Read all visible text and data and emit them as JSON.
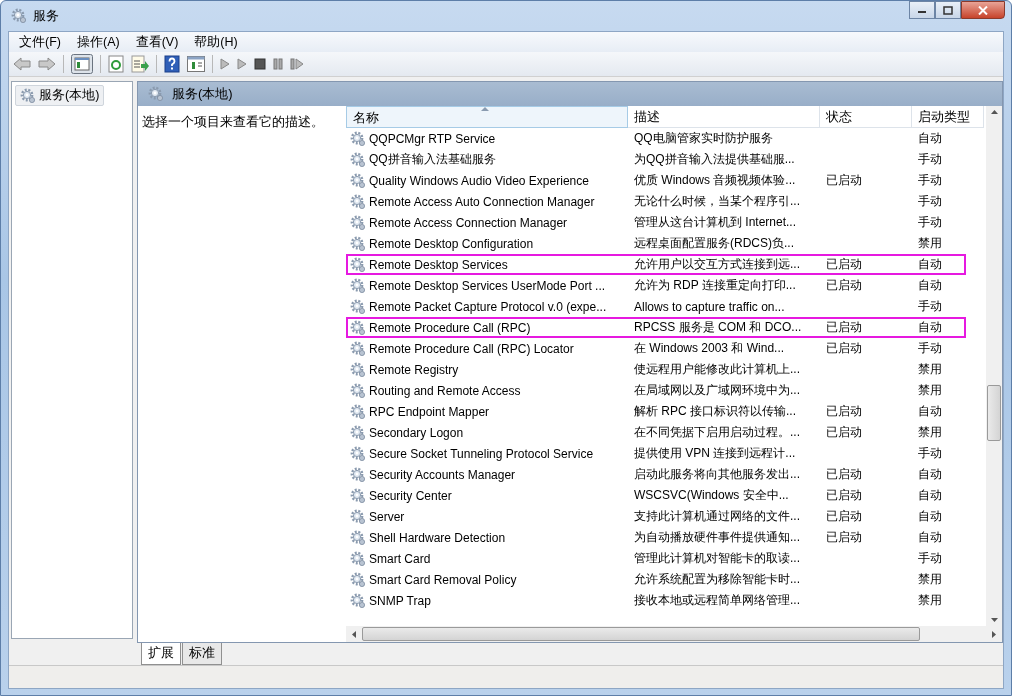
{
  "window": {
    "title": "服务"
  },
  "menu": [
    "文件(F)",
    "操作(A)",
    "查看(V)",
    "帮助(H)"
  ],
  "tree": {
    "items": [
      {
        "label": "服务(本地)",
        "selected": true
      }
    ]
  },
  "panel": {
    "title": "服务(本地)",
    "description": "选择一个项目来查看它的描述。"
  },
  "table": {
    "columns": [
      {
        "label": "名称",
        "sorted": true
      },
      {
        "label": "描述",
        "sorted": false
      },
      {
        "label": "状态",
        "sorted": false
      },
      {
        "label": "启动类型",
        "sorted": false
      }
    ],
    "rows": [
      {
        "name": "QQPCMgr RTP Service",
        "description": "QQ电脑管家实时防护服务",
        "status": "",
        "startup": "自动",
        "highlighted": false
      },
      {
        "name": "QQ拼音输入法基础服务",
        "description": "为QQ拼音输入法提供基础服...",
        "status": "",
        "startup": "手动",
        "highlighted": false
      },
      {
        "name": "Quality Windows Audio Video Experience",
        "description": "优质 Windows 音频视频体验...",
        "status": "已启动",
        "startup": "手动",
        "highlighted": false
      },
      {
        "name": "Remote Access Auto Connection Manager",
        "description": "无论什么时候，当某个程序引...",
        "status": "",
        "startup": "手动",
        "highlighted": false
      },
      {
        "name": "Remote Access Connection Manager",
        "description": "管理从这台计算机到 Internet...",
        "status": "",
        "startup": "手动",
        "highlighted": false
      },
      {
        "name": "Remote Desktop Configuration",
        "description": "远程桌面配置服务(RDCS)负...",
        "status": "",
        "startup": "禁用",
        "highlighted": false
      },
      {
        "name": "Remote Desktop Services",
        "description": "允许用户以交互方式连接到远...",
        "status": "已启动",
        "startup": "自动",
        "highlighted": true
      },
      {
        "name": "Remote Desktop Services UserMode Port ...",
        "description": "允许为 RDP 连接重定向打印...",
        "status": "已启动",
        "startup": "自动",
        "highlighted": false
      },
      {
        "name": "Remote Packet Capture Protocol v.0 (expe...",
        "description": "Allows to capture traffic on...",
        "status": "",
        "startup": "手动",
        "highlighted": false
      },
      {
        "name": "Remote Procedure Call (RPC)",
        "description": "RPCSS 服务是 COM 和 DCO...",
        "status": "已启动",
        "startup": "自动",
        "highlighted": true
      },
      {
        "name": "Remote Procedure Call (RPC) Locator",
        "description": "在 Windows 2003 和 Wind...",
        "status": "已启动",
        "startup": "手动",
        "highlighted": false
      },
      {
        "name": "Remote Registry",
        "description": "使远程用户能修改此计算机上...",
        "status": "",
        "startup": "禁用",
        "highlighted": false
      },
      {
        "name": "Routing and Remote Access",
        "description": "在局域网以及广域网环境中为...",
        "status": "",
        "startup": "禁用",
        "highlighted": false
      },
      {
        "name": "RPC Endpoint Mapper",
        "description": "解析 RPC 接口标识符以传输...",
        "status": "已启动",
        "startup": "自动",
        "highlighted": false
      },
      {
        "name": "Secondary Logon",
        "description": "在不同凭据下启用启动过程。...",
        "status": "已启动",
        "startup": "禁用",
        "highlighted": false
      },
      {
        "name": "Secure Socket Tunneling Protocol Service",
        "description": "提供使用 VPN 连接到远程计...",
        "status": "",
        "startup": "手动",
        "highlighted": false
      },
      {
        "name": "Security Accounts Manager",
        "description": "启动此服务将向其他服务发出...",
        "status": "已启动",
        "startup": "自动",
        "highlighted": false
      },
      {
        "name": "Security Center",
        "description": "WSCSVC(Windows 安全中...",
        "status": "已启动",
        "startup": "自动",
        "highlighted": false
      },
      {
        "name": "Server",
        "description": "支持此计算机通过网络的文件...",
        "status": "已启动",
        "startup": "自动",
        "highlighted": false
      },
      {
        "name": "Shell Hardware Detection",
        "description": "为自动播放硬件事件提供通知...",
        "status": "已启动",
        "startup": "自动",
        "highlighted": false
      },
      {
        "name": "Smart Card",
        "description": "管理此计算机对智能卡的取读...",
        "status": "",
        "startup": "手动",
        "highlighted": false
      },
      {
        "name": "Smart Card Removal Policy",
        "description": "允许系统配置为移除智能卡时...",
        "status": "",
        "startup": "禁用",
        "highlighted": false
      },
      {
        "name": "SNMP Trap",
        "description": "接收本地或远程简单网络管理...",
        "status": "",
        "startup": "禁用",
        "highlighted": false
      }
    ]
  },
  "tabs": [
    {
      "label": "扩展",
      "selected": true
    },
    {
      "label": "标准",
      "selected": false
    }
  ]
}
